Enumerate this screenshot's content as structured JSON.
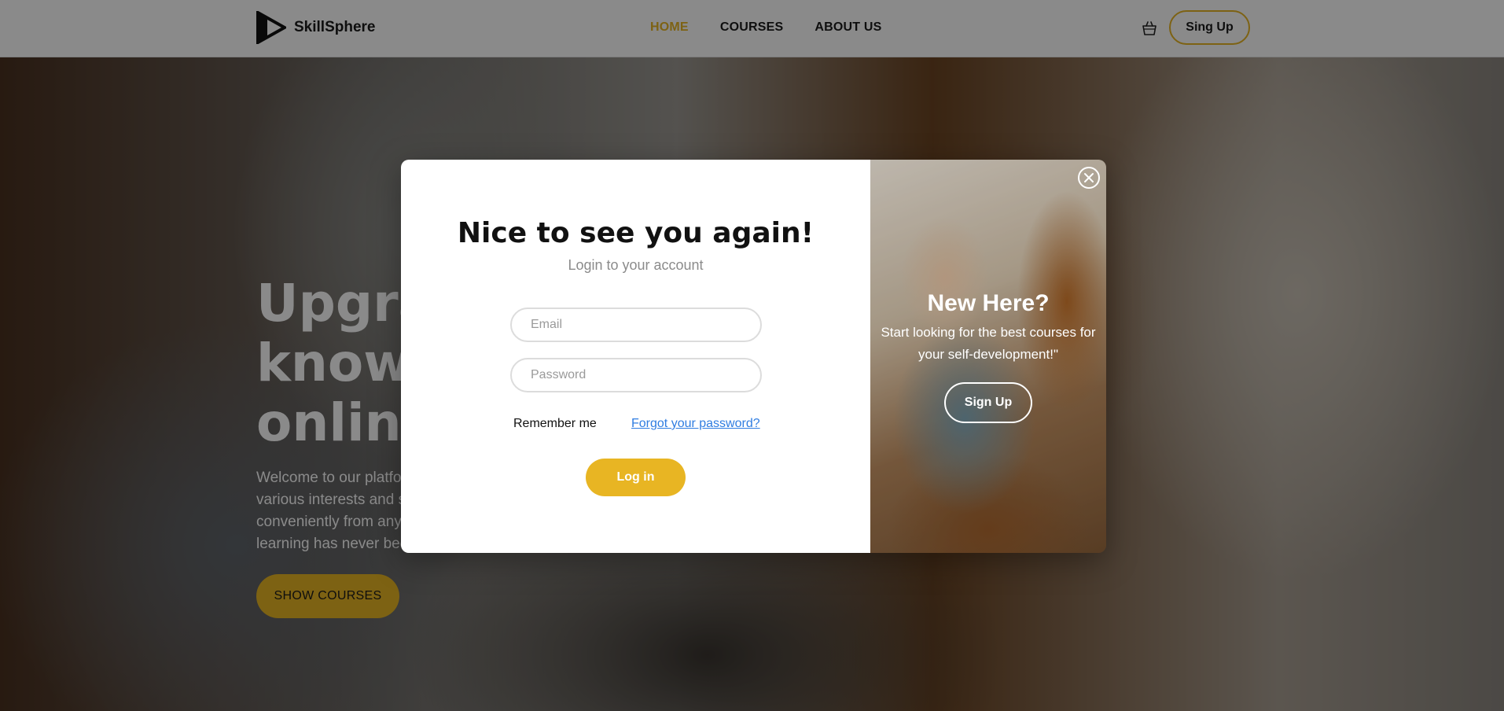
{
  "brand": {
    "name": "SkillSphere"
  },
  "nav": {
    "links": [
      {
        "label": "HOME",
        "active": true
      },
      {
        "label": "COURSES",
        "active": false
      },
      {
        "label": "ABOUT US",
        "active": false
      }
    ],
    "cart_icon": "shopping-basket-icon",
    "signup_label": "Sing Up"
  },
  "hero": {
    "title_lines": [
      "Upgrade your",
      "knowledge",
      "online"
    ],
    "description_lines": [
      "Welcome to our platform with courses on",
      "various interests and subjects. Study",
      "conveniently from anywhere, anytime —",
      "learning has never been easier."
    ],
    "button_label": "SHOW COURSES"
  },
  "modal": {
    "title": "Nice to see you again!",
    "subtitle": "Login to your account",
    "email_placeholder": "Email",
    "password_placeholder": "Password",
    "remember_label": "Remember me",
    "forgot_label": "Forgot your password?",
    "login_label": "Log in",
    "close_icon": "close-icon",
    "promo": {
      "heading": "New Here?",
      "text": "Start looking for the best courses for your self-development!\"",
      "button_label": "Sign Up"
    }
  },
  "colors": {
    "accent": "#e8b523",
    "link": "#2f7de1",
    "overlay": "rgba(0,0,0,0.46)"
  }
}
